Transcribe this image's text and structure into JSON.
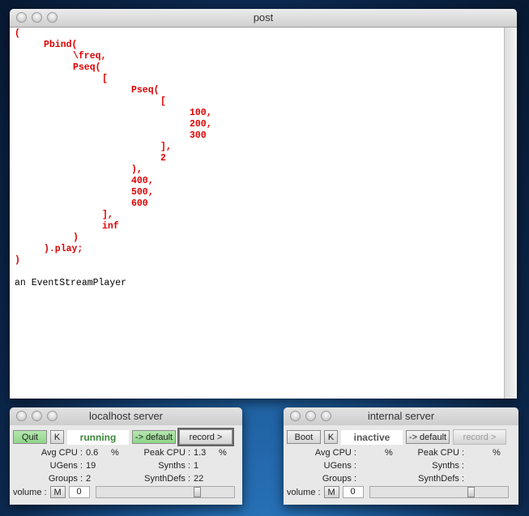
{
  "post": {
    "title": "post",
    "code": [
      [
        "0",
        "("
      ],
      [
        "1",
        "Pbind("
      ],
      [
        "2",
        "\\freq,"
      ],
      [
        "2",
        "Pseq("
      ],
      [
        "3",
        "["
      ],
      [
        "4",
        "Pseq("
      ],
      [
        "5",
        "["
      ],
      [
        "6",
        "100,"
      ],
      [
        "6",
        "200,"
      ],
      [
        "6",
        "300"
      ],
      [
        "5",
        "],"
      ],
      [
        "5",
        "2"
      ],
      [
        "4",
        "),"
      ],
      [
        "4",
        "400,"
      ],
      [
        "4",
        "500,"
      ],
      [
        "4",
        "600"
      ],
      [
        "3",
        "],"
      ],
      [
        "3",
        "inf"
      ],
      [
        "2",
        ")"
      ],
      [
        "1",
        ").play;"
      ],
      [
        "0",
        ")"
      ]
    ],
    "output": "an EventStreamPlayer"
  },
  "servers": [
    {
      "title": "localhost server",
      "boot_label": "Quit",
      "kill_label": "K",
      "status": "running",
      "default_label": "-> default",
      "record_label": "record >",
      "avg_cpu_label": "Avg CPU :",
      "avg_cpu": "0.6",
      "peak_cpu_label": "Peak CPU :",
      "peak_cpu": "1.3",
      "pct": "%",
      "ugens_label": "UGens :",
      "ugens": "19",
      "synths_label": "Synths :",
      "synths": "1",
      "groups_label": "Groups :",
      "groups": "2",
      "synthdefs_label": "SynthDefs :",
      "synthdefs": "22",
      "volume_label": "volume :",
      "mute_label": "M",
      "volume": "0",
      "slider_fraction": 0.75
    },
    {
      "title": "internal server",
      "boot_label": "Boot",
      "kill_label": "K",
      "status": "inactive",
      "default_label": "-> default",
      "record_label": "record >",
      "avg_cpu_label": "Avg CPU :",
      "avg_cpu": "",
      "peak_cpu_label": "Peak CPU :",
      "peak_cpu": "",
      "pct": "%",
      "ugens_label": "UGens :",
      "ugens": "",
      "synths_label": "Synths :",
      "synths": "",
      "groups_label": "Groups :",
      "groups": "",
      "synthdefs_label": "SynthDefs :",
      "synthdefs": "",
      "volume_label": "volume :",
      "mute_label": "M",
      "volume": "0",
      "slider_fraction": 0.75
    }
  ]
}
